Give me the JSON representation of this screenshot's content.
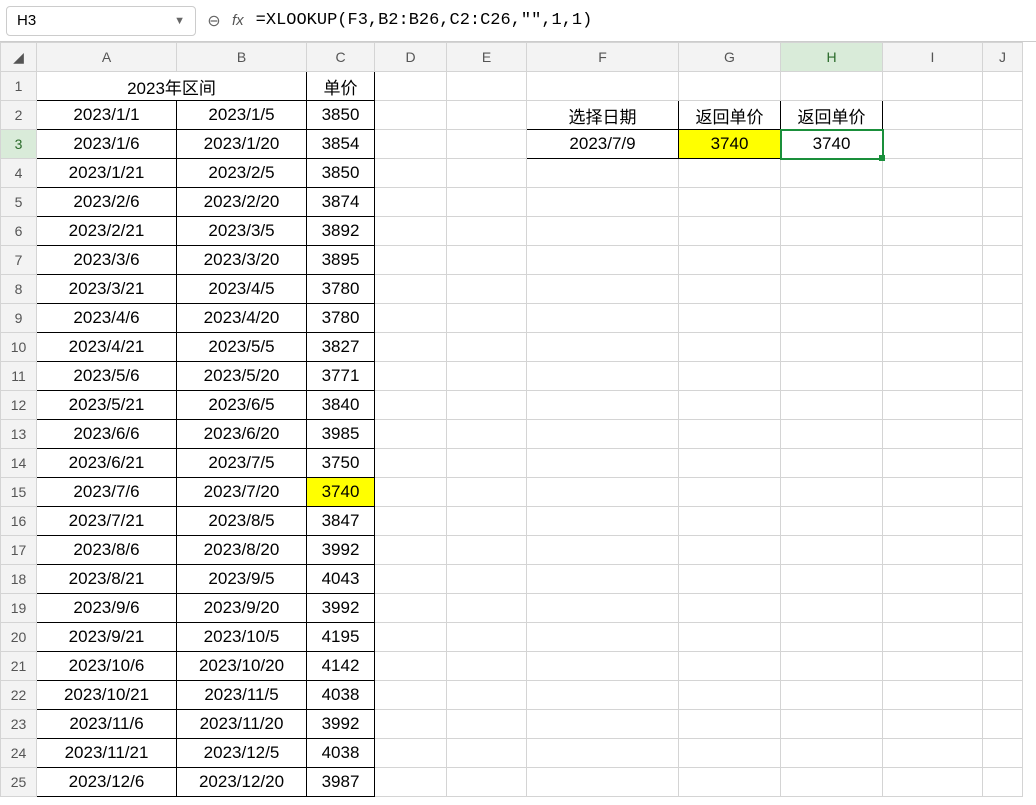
{
  "formula_bar": {
    "cell_ref": "H3",
    "fx_label": "fx",
    "formula": "=XLOOKUP(F3,B2:B26,C2:C26,\"\",1,1)"
  },
  "columns": [
    "A",
    "B",
    "C",
    "D",
    "E",
    "F",
    "G",
    "H",
    "I",
    "J"
  ],
  "row_count": 25,
  "headers": {
    "date_range_title": "2023年区间",
    "price_title": "单价",
    "select_date": "选择日期",
    "return_price_1": "返回单价",
    "return_price_2": "返回单价"
  },
  "lookup": {
    "date": "2023/7/9",
    "g3": "3740",
    "h3": "3740"
  },
  "data_rows": [
    {
      "a": "2023/1/1",
      "b": "2023/1/5",
      "c": "3850"
    },
    {
      "a": "2023/1/6",
      "b": "2023/1/20",
      "c": "3854"
    },
    {
      "a": "2023/1/21",
      "b": "2023/2/5",
      "c": "3850"
    },
    {
      "a": "2023/2/6",
      "b": "2023/2/20",
      "c": "3874"
    },
    {
      "a": "2023/2/21",
      "b": "2023/3/5",
      "c": "3892"
    },
    {
      "a": "2023/3/6",
      "b": "2023/3/20",
      "c": "3895"
    },
    {
      "a": "2023/3/21",
      "b": "2023/4/5",
      "c": "3780"
    },
    {
      "a": "2023/4/6",
      "b": "2023/4/20",
      "c": "3780"
    },
    {
      "a": "2023/4/21",
      "b": "2023/5/5",
      "c": "3827"
    },
    {
      "a": "2023/5/6",
      "b": "2023/5/20",
      "c": "3771"
    },
    {
      "a": "2023/5/21",
      "b": "2023/6/5",
      "c": "3840"
    },
    {
      "a": "2023/6/6",
      "b": "2023/6/20",
      "c": "3985"
    },
    {
      "a": "2023/6/21",
      "b": "2023/7/5",
      "c": "3750"
    },
    {
      "a": "2023/7/6",
      "b": "2023/7/20",
      "c": "3740",
      "hl": true
    },
    {
      "a": "2023/7/21",
      "b": "2023/8/5",
      "c": "3847"
    },
    {
      "a": "2023/8/6",
      "b": "2023/8/20",
      "c": "3992"
    },
    {
      "a": "2023/8/21",
      "b": "2023/9/5",
      "c": "4043"
    },
    {
      "a": "2023/9/6",
      "b": "2023/9/20",
      "c": "3992"
    },
    {
      "a": "2023/9/21",
      "b": "2023/10/5",
      "c": "4195"
    },
    {
      "a": "2023/10/6",
      "b": "2023/10/20",
      "c": "4142"
    },
    {
      "a": "2023/10/21",
      "b": "2023/11/5",
      "c": "4038"
    },
    {
      "a": "2023/11/6",
      "b": "2023/11/20",
      "c": "3992"
    },
    {
      "a": "2023/11/21",
      "b": "2023/12/5",
      "c": "4038"
    },
    {
      "a": "2023/12/6",
      "b": "2023/12/20",
      "c": "3987"
    }
  ]
}
